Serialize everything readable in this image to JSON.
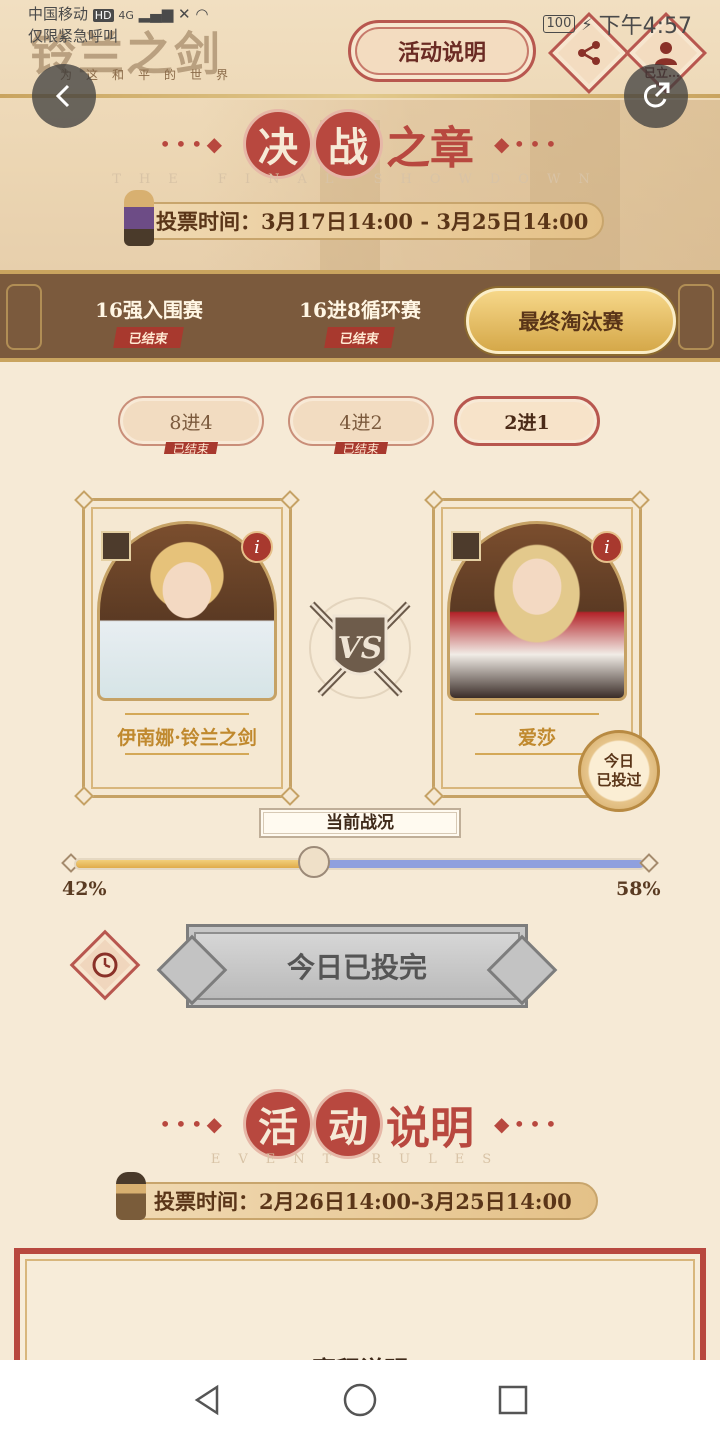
{
  "status_bar": {
    "carrier": "中国移动",
    "hd": "HD",
    "network": "4G",
    "emergency": "仅限紧急呼叫",
    "battery": "100",
    "time": "下午4:57"
  },
  "header": {
    "game_logo": "铃兰之剑",
    "logo_sub": "为这和平的世界",
    "rules_button": "活动说明",
    "profile_label": "已立…"
  },
  "showdown": {
    "title_circle_1": "决",
    "title_circle_2": "战",
    "title_rest": "之章",
    "title_en": "THE FINAL SHOWDOWN",
    "vote_time": "投票时间：3月17日14:00 - 3月25日14:00"
  },
  "stages": [
    {
      "label": "16强入围赛",
      "status": "已结束"
    },
    {
      "label": "16进8循环赛",
      "status": "已结束"
    },
    {
      "label": "最终淘汰赛"
    }
  ],
  "rounds": [
    {
      "label": "8进4",
      "status": "已结束"
    },
    {
      "label": "4进2",
      "status": "已结束"
    },
    {
      "label": "2进1"
    }
  ],
  "contestants": {
    "left": {
      "name": "伊南娜·铃兰之剑",
      "info": "i"
    },
    "right": {
      "name": "爱莎",
      "info": "i",
      "seal": "今日\n已投过"
    }
  },
  "battle": {
    "label": "当前战况",
    "left_pct_text": "42%",
    "right_pct_text": "58%",
    "left_fraction": 0.42
  },
  "vote_button": "今日已投完",
  "event": {
    "title_circle_1": "活",
    "title_circle_2": "动",
    "title_rest": "说明",
    "title_en": "EVENT RULES",
    "vote_time": "投票时间：2月26日14:00-3月25日14:00",
    "panel_heading": "赛程说明"
  },
  "colors": {
    "accent_red": "#b8483f",
    "gold": "#c9a45f",
    "bar_left": "#e0ac4a",
    "bar_right": "#8fa0de"
  }
}
